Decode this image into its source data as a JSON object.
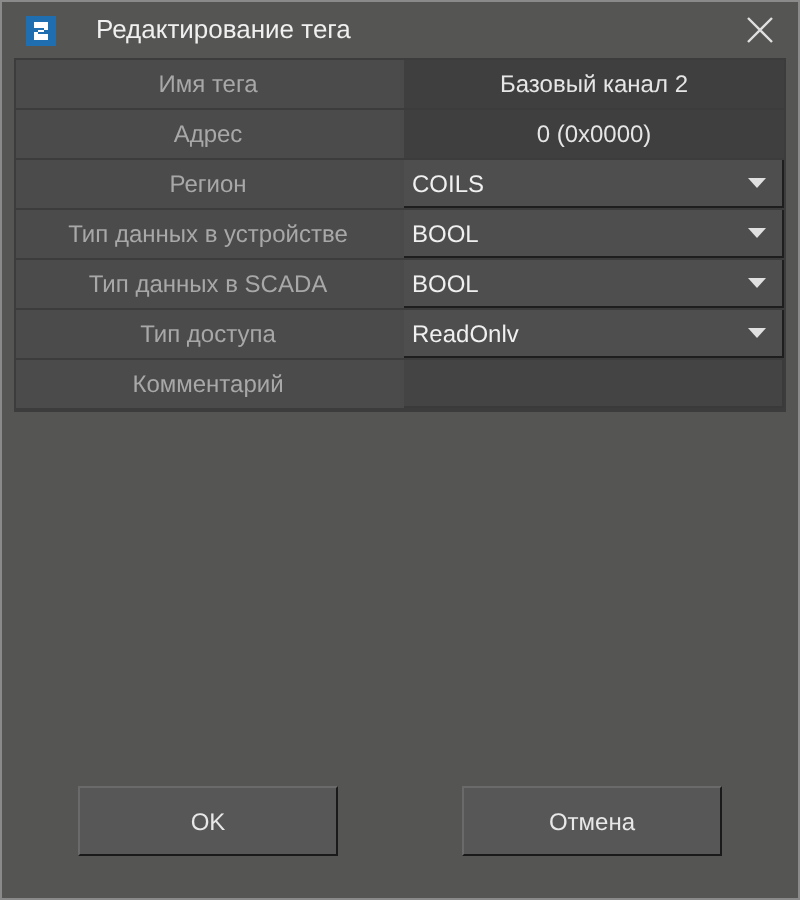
{
  "window": {
    "title": "Редактирование тега"
  },
  "fields": [
    {
      "label": "Имя тега",
      "kind": "text",
      "value": "Базовый канал 2"
    },
    {
      "label": "Адрес",
      "kind": "text",
      "value": "0 (0x0000)"
    },
    {
      "label": "Регион",
      "kind": "select",
      "value": "COILS"
    },
    {
      "label": "Тип данных в устройстве",
      "kind": "select",
      "value": "BOOL"
    },
    {
      "label": "Тип данных в SCADA",
      "kind": "select",
      "value": "BOOL"
    },
    {
      "label": "Тип доступа",
      "kind": "select",
      "value": "ReadOnlv"
    },
    {
      "label": "Комментарий",
      "kind": "input"
    }
  ],
  "buttons": [
    "OK",
    "Отмена"
  ]
}
